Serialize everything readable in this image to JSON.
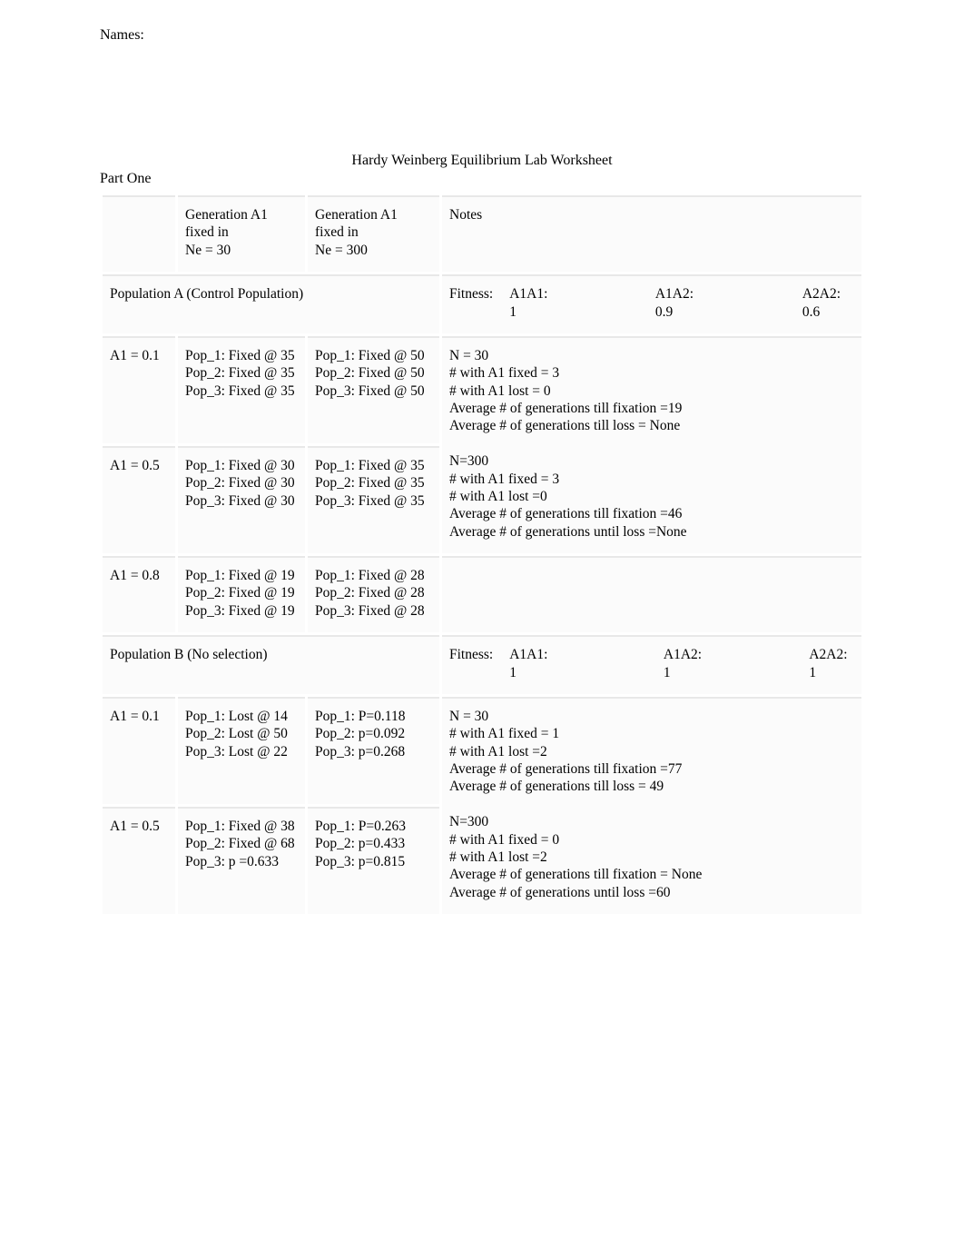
{
  "names_label": "Names:",
  "title": "Hardy Weinberg Equilibrium Lab Worksheet",
  "part_label": "Part One",
  "header": {
    "col2": "Generation A1\nfixed in\nNe = 30",
    "col3": "Generation A1\nfixed in\nNe = 300",
    "col4": "Notes"
  },
  "popA": {
    "label": "Population A   (Control Population)",
    "fitness_label": "Fitness:",
    "f1": "A1A1: 1",
    "f2": "A1A2: 0.9",
    "f3": "A2A2: 0.6"
  },
  "rowsA": [
    {
      "a1": "A1 = 0.1",
      "ne30": "Pop_1: Fixed @ 35\nPop_2: Fixed @ 35\nPop_3: Fixed @ 35",
      "ne300": "Pop_1: Fixed @ 50\nPop_2: Fixed @ 50\nPop_3: Fixed @ 50",
      "notes": "N = 30\n# with A1 fixed = 3\n# with A1 lost = 0\nAverage # of generations till fixation =19\nAverage # of generations till loss = None"
    },
    {
      "a1": "A1 = 0.5",
      "ne30": "Pop_1: Fixed @ 30\nPop_2: Fixed @ 30\nPop_3: Fixed @ 30",
      "ne300": "Pop_1: Fixed @ 35\nPop_2: Fixed @ 35\nPop_3: Fixed @ 35",
      "notes": "N=300\n# with A1 fixed = 3\n# with A1 lost =0\nAverage # of generations till fixation =46\nAverage # of generations until loss =None"
    },
    {
      "a1": "A1 = 0.8",
      "ne30": "Pop_1: Fixed @ 19\nPop_2: Fixed @ 19\nPop_3: Fixed @ 19",
      "ne300": " Pop_1: Fixed @ 28\nPop_2: Fixed @ 28\nPop_3: Fixed @ 28",
      "notes": ""
    }
  ],
  "popB": {
    "label": "Population B   (No selection)",
    "fitness_label": "Fitness:",
    "f1": "A1A1: 1",
    "f2": "A1A2: 1",
    "f3": "A2A2: 1"
  },
  "rowsB": [
    {
      "a1": "A1 = 0.1",
      "ne30": "Pop_1: Lost @ 14\nPop_2: Lost @ 50\nPop_3: Lost @ 22",
      "ne300": "Pop_1: P=0.118\nPop_2: p=0.092\nPop_3: p=0.268",
      "notes": "N = 30\n# with A1 fixed = 1\n# with A1 lost =2\nAverage # of generations till fixation =77\nAverage # of generations till loss = 49"
    },
    {
      "a1": "A1 = 0.5",
      "ne30": "Pop_1: Fixed @ 38\nPop_2: Fixed @ 68\nPop_3: p =0.633",
      "ne300": "Pop_1: P=0.263\nPop_2: p=0.433\nPop_3: p=0.815",
      "notes": "N=300\n# with A1 fixed = 0\n# with A1 lost =2\nAverage # of generations till fixation = None\nAverage # of generations until loss =60"
    }
  ]
}
